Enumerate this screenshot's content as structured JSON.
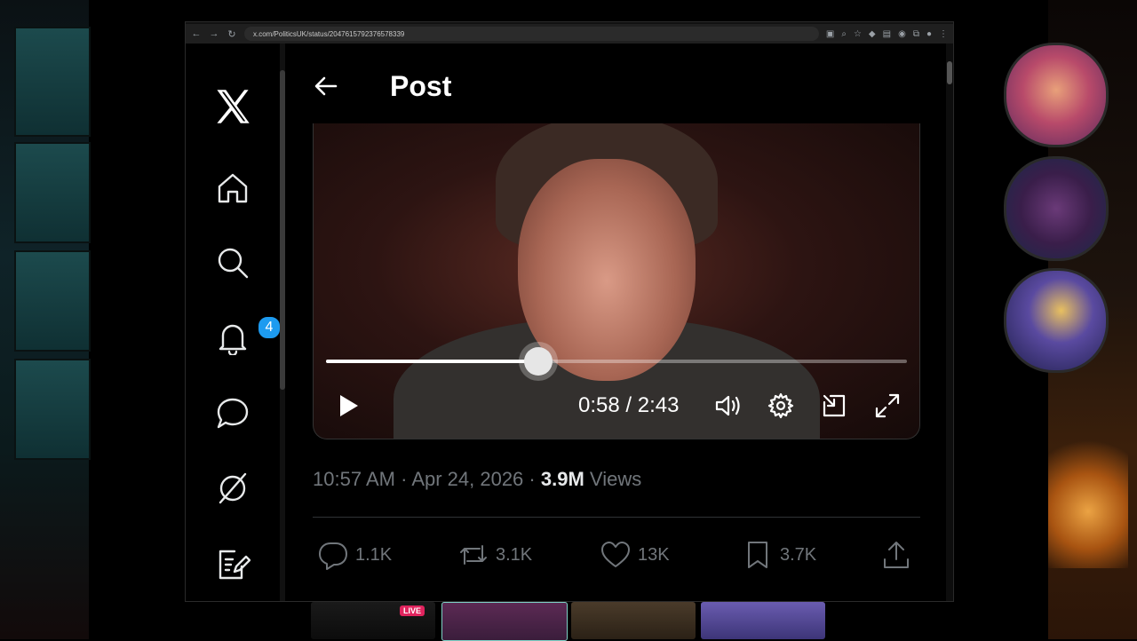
{
  "browser": {
    "url": "x.com/PoliticsUK/status/2047615792376578339"
  },
  "sidebar": {
    "logo_icon": "x-logo-icon",
    "items": [
      {
        "name": "home",
        "icon": "home-icon"
      },
      {
        "name": "explore",
        "icon": "search-icon"
      },
      {
        "name": "notifications",
        "icon": "bell-icon",
        "badge": "4"
      },
      {
        "name": "messages",
        "icon": "chat-bubble-icon"
      },
      {
        "name": "grok",
        "icon": "grok-icon"
      },
      {
        "name": "compose",
        "icon": "compose-icon"
      }
    ]
  },
  "header": {
    "title": "Post"
  },
  "video": {
    "progress_fraction": 0.365,
    "time": "0:58 / 2:43"
  },
  "post": {
    "time": "10:57 AM",
    "separator": "·",
    "date": "Apr 24, 2026",
    "views_count": "3.9M",
    "views_label": "Views"
  },
  "actions": {
    "replies": "1.1K",
    "reposts": "3.1K",
    "likes": "13K",
    "bookmarks": "3.7K"
  },
  "related_strip": {
    "live_label": "LIVE"
  },
  "colors": {
    "accent": "#1d9bf0",
    "muted": "#71767b",
    "live": "#e0245e"
  }
}
